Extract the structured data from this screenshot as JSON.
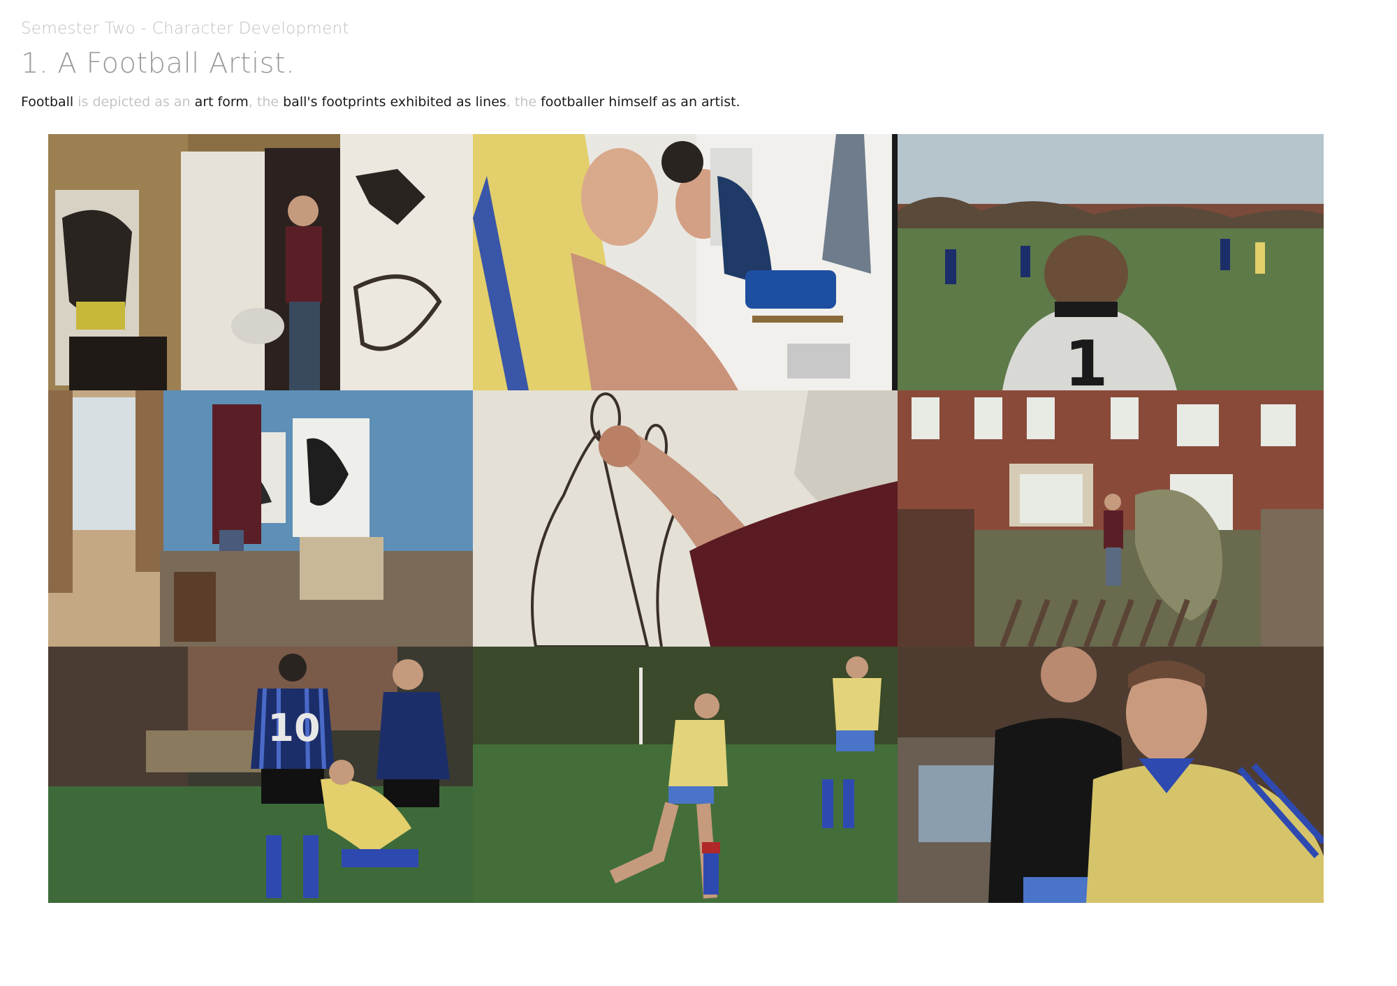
{
  "header": {
    "subtitle": "Semester Two - Character Development",
    "title": "1. A Football Artist."
  },
  "caption": {
    "parts": [
      {
        "text": "Football",
        "style": "strong"
      },
      {
        "text": " is depicted as an ",
        "style": "muted"
      },
      {
        "text": "art form",
        "style": "strong"
      },
      {
        "text": ", the ",
        "style": "muted"
      },
      {
        "text": "ball's footprints exhibited as lines",
        "style": "strong"
      },
      {
        "text": ", the ",
        "style": "muted"
      },
      {
        "text": "footballer himself as an artist.",
        "style": "strong"
      }
    ]
  },
  "colors": {
    "text_strong": "#1a1a1a",
    "text_muted": "#c4c4c4",
    "title": "#9a9a9a",
    "subtitle": "#c0c0c0"
  },
  "stills": [
    {
      "id": "studio-doorway",
      "shirt_number": ""
    },
    {
      "id": "changing-room-bench",
      "shirt_number": ""
    },
    {
      "id": "goalkeeper-on-pitch",
      "shirt_number": "1"
    },
    {
      "id": "studio-blue-wall",
      "shirt_number": ""
    },
    {
      "id": "drawing-on-paper",
      "shirt_number": ""
    },
    {
      "id": "terraced-house",
      "shirt_number": ""
    },
    {
      "id": "tackle-number-ten",
      "shirt_number": "10"
    },
    {
      "id": "players-running",
      "shirt_number": ""
    },
    {
      "id": "player-closeup",
      "shirt_number": ""
    }
  ]
}
